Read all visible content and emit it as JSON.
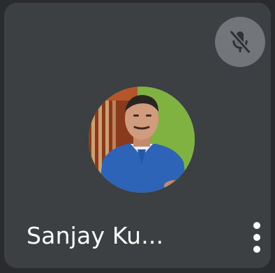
{
  "participant": {
    "name": "Sanjay Ku...",
    "mic_status_icon": "mic-off-icon",
    "more_options_icon": "more-vert-icon"
  },
  "colors": {
    "tile_background": "#3c4043",
    "mute_indicator_background": "#72767a",
    "text": "#ffffff"
  }
}
